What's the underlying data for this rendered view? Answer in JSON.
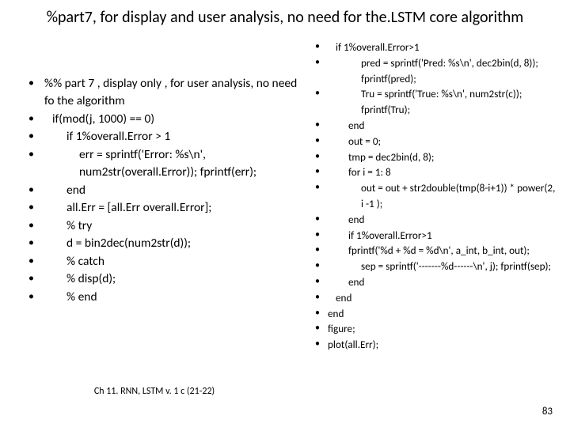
{
  "title": "%part7, for display and user analysis, no need for the.LSTM core algorithm",
  "left": [
    " %% part 7 , display only , for user analysis, no need fo the algorithm",
    "    if(mod(j, 1000) == 0)",
    "        if 1%overall.Error > 1",
    "            err = sprintf('Error: %s\\n', num2str(overall.Error)); fprintf(err);",
    "        end",
    "        all.Err = [all.Err overall.Error];",
    "        %         try",
    "        d = bin2dec(num2str(d));",
    "        %         catch",
    "        %             disp(d);",
    "        %         end"
  ],
  "right": [
    "    if 1%overall.Error>1",
    "            pred = sprintf('Pred: %s\\n', dec2bin(d, 8)); fprintf(pred);",
    "            Tru = sprintf('True: %s\\n', num2str(c)); fprintf(Tru);",
    "        end",
    "        out = 0;",
    "        tmp = dec2bin(d, 8);",
    "        for i = 1: 8",
    "            out = out + str2double(tmp(8-i+1)) * power(2, i -1 );",
    "        end",
    "        if 1%overall.Error>1",
    "        fprintf('%d + %d = %d\\n', a_int, b_int, out);",
    "            sep = sprintf('-------%d------\\n', j); fprintf(sep);",
    "        end",
    "    end",
    "end",
    "figure;",
    "plot(all.Err);"
  ],
  "footer": "Ch 11. RNN, LSTM v. 1 c (21-22)",
  "pagenum": "83"
}
